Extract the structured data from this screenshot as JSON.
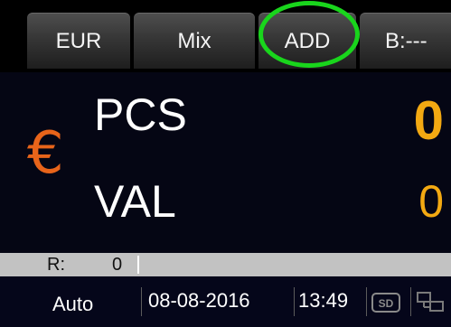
{
  "tabs": {
    "currency": "EUR",
    "mode": "Mix",
    "add": "ADD",
    "batch": "B:---"
  },
  "main": {
    "currency_symbol": "€",
    "pieces_label": "PCS",
    "pieces_value": "0",
    "value_label": "VAL",
    "value_value": "0"
  },
  "reject": {
    "label": "R:",
    "value": "0"
  },
  "status": {
    "mode": "Auto",
    "date": "08-08-2016",
    "time": "13:49",
    "icons": [
      "sd-card-icon",
      "network-icon"
    ]
  },
  "colors": {
    "accent_orange": "#f3a912",
    "currency_orange": "#e8641a",
    "highlight_green": "#19d51c",
    "background": "#05061a"
  }
}
